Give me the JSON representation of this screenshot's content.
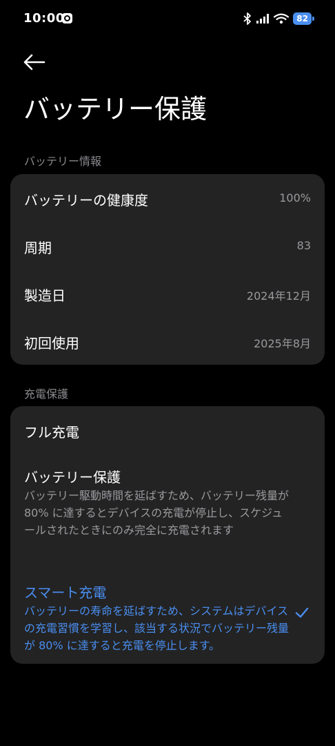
{
  "status_bar": {
    "time": "10:00",
    "battery_level": "82"
  },
  "header": {
    "title": "バッテリー保護"
  },
  "battery_info": {
    "section_label": "バッテリー情報",
    "rows": [
      {
        "label": "バッテリーの健康度",
        "value": "100%"
      },
      {
        "label": "周期",
        "value": "83"
      },
      {
        "label": "製造日",
        "value": "2024年12月"
      },
      {
        "label": "初回使用",
        "value": "2025年8月"
      }
    ]
  },
  "charge_protection": {
    "section_label": "充電保護",
    "options": [
      {
        "title": "フル充電",
        "description": ""
      },
      {
        "title": "バッテリー保護",
        "description": "バッテリー駆動時間を延ばすため、バッテリー残量が 80% に達するとデバイスの充電が停止し、スケジュールされたときにのみ完全に充電されます"
      },
      {
        "title": "スマート充電",
        "description": "バッテリーの寿命を延ばすため、システムはデバイスの充電習慣を学習し、該当する状況でバッテリー残量が 80% に達すると充電を停止します。"
      }
    ],
    "selected_index": 2
  },
  "colors": {
    "background": "#000000",
    "card": "#232323",
    "accent": "#4a8ef0",
    "secondary_text": "#9a9a9f"
  }
}
